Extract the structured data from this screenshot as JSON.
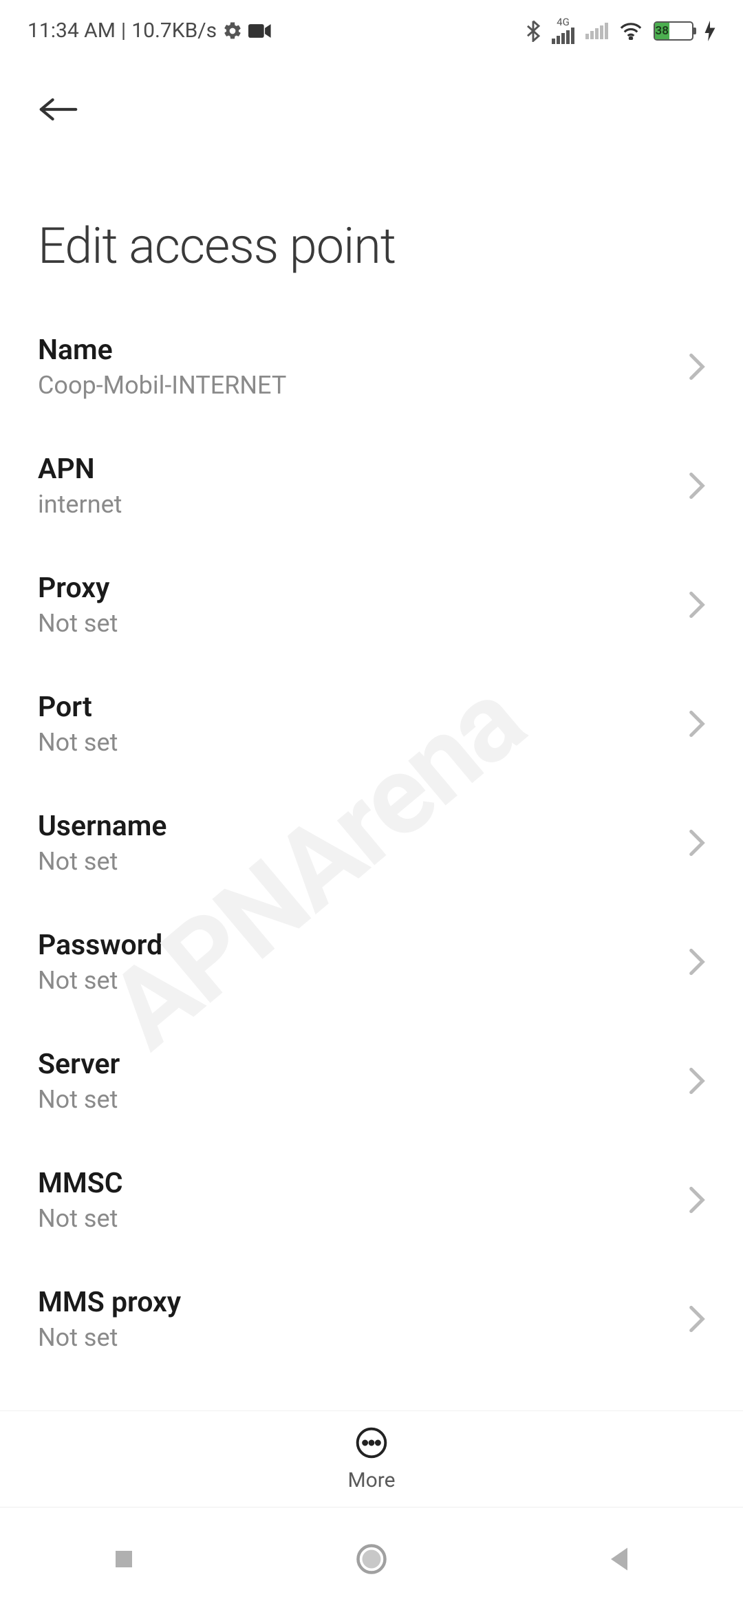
{
  "status": {
    "time": "11:34 AM",
    "net_speed": "10.7KB/s",
    "battery_pct": "38",
    "signal_label": "4G"
  },
  "header": {
    "title": "Edit access point"
  },
  "settings": [
    {
      "label": "Name",
      "value": "Coop-Mobil-INTERNET"
    },
    {
      "label": "APN",
      "value": "internet"
    },
    {
      "label": "Proxy",
      "value": "Not set"
    },
    {
      "label": "Port",
      "value": "Not set"
    },
    {
      "label": "Username",
      "value": "Not set"
    },
    {
      "label": "Password",
      "value": "Not set"
    },
    {
      "label": "Server",
      "value": "Not set"
    },
    {
      "label": "MMSC",
      "value": "Not set"
    },
    {
      "label": "MMS proxy",
      "value": "Not set"
    }
  ],
  "bottom": {
    "more_label": "More"
  },
  "watermark": "APNArena"
}
